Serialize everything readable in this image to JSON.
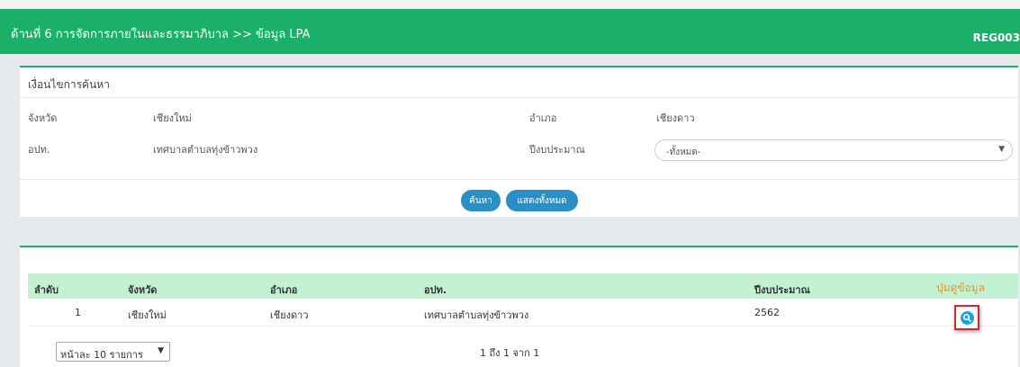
{
  "header": {
    "title": "ด้านที่ 6 การจัดการภายในและธรรมาภิบาล >> ข้อมูล LPA",
    "code": "REG003"
  },
  "search": {
    "title": "เงื่อนไขการค้นหา",
    "province_label": "จังหวัด",
    "province_value": "เชียงใหม่",
    "district_label": "อำเภอ",
    "district_value": "เชียงดาว",
    "lao_label": "อปท.",
    "lao_value": "เทศบาลตำบลทุ่งข้าวพวง",
    "budget_year_label": "ปีงบประมาณ",
    "budget_year_value": "-ทั้งหมด-",
    "search_button": "ค้นหา",
    "show_all_button": "แสดงทั้งหมด"
  },
  "table": {
    "columns": [
      "ลำดับ",
      "จังหวัด",
      "อำเภอ",
      "อปท.",
      "ปีงบประมาณ",
      "ปุ่มดูข้อมูล"
    ],
    "rows": [
      {
        "no": "1",
        "province": "เชียงใหม่",
        "district": "เชียงดาว",
        "lao": "เทศบาลตำบลทุ่งข้าวพวง",
        "year": "2562"
      }
    ]
  },
  "pagination": {
    "page_size": "หน้าละ 10 รายการ",
    "summary": "1 ถึง 1 จาก 1"
  },
  "colors": {
    "header_green": "#1ab068",
    "table_header_bg": "#c3f1d4",
    "button_blue": "#2a8fc4",
    "view_icon_blue": "#17a5e6",
    "highlight_red": "#d9262c",
    "action_column_orange": "#e8962a"
  }
}
